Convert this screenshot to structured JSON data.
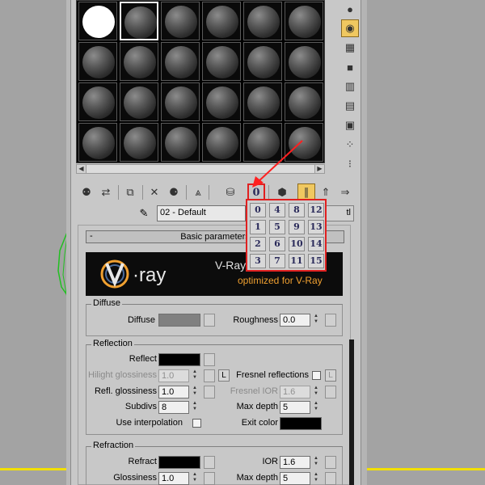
{
  "material_editor": {
    "bottom_toolbar": {
      "slot_count_button_label": "0",
      "slot_count_popup": [
        "0",
        "4",
        "8",
        "12",
        "1",
        "5",
        "9",
        "13",
        "2",
        "6",
        "10",
        "14",
        "3",
        "7",
        "11",
        "15"
      ]
    },
    "material": {
      "name": "02 - Default",
      "type_label": "tl"
    },
    "rollout": {
      "title": "Basic parameters",
      "collapse_symbol": "-"
    },
    "vray_banner": {
      "logo_text": "v·ray",
      "title": "V-Ray",
      "title_suffix": "r",
      "subtitle": "optimized for V-Ray"
    },
    "diffuse": {
      "group_title": "Diffuse",
      "diffuse_label": "Diffuse",
      "roughness_label": "Roughness",
      "roughness_value": "0.0",
      "diffuse_color": "#808080"
    },
    "reflection": {
      "group_title": "Reflection",
      "reflect_label": "Reflect",
      "reflect_color": "#000000",
      "hilight_label": "Hilight glossiness",
      "hilight_value": "1.0",
      "l_button": "L",
      "fresnel_label": "Fresnel reflections",
      "fresnel_l": "L",
      "refl_gloss_label": "Refl. glossiness",
      "refl_gloss_value": "1.0",
      "fresnel_ior_label": "Fresnel IOR",
      "fresnel_ior_value": "1.6",
      "subdivs_label": "Subdivs",
      "subdivs_value": "8",
      "max_depth_label": "Max depth",
      "max_depth_value": "5",
      "use_interp_label": "Use interpolation",
      "exit_color_label": "Exit color",
      "exit_color": "#000000"
    },
    "refraction": {
      "group_title": "Refraction",
      "refract_label": "Refract",
      "refract_color": "#000000",
      "ior_label": "IOR",
      "ior_value": "1.6",
      "glossiness_label": "Glossiness",
      "glossiness_value": "1.0",
      "max_depth_label": "Max depth",
      "max_depth_value": "5"
    }
  }
}
